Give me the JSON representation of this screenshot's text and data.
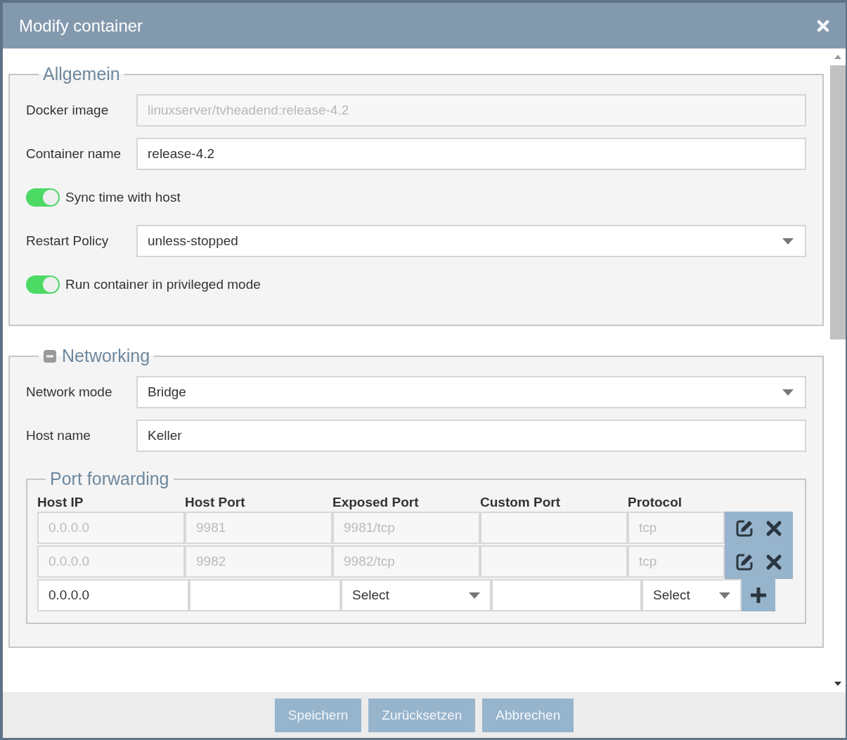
{
  "dialog": {
    "title": "Modify container"
  },
  "sections": [
    {
      "legend": "Allgemein",
      "fields": [
        {
          "kind": "text",
          "label": "Docker image",
          "value": "linuxserver/tvheadend:release-4.2",
          "disabled": true
        },
        {
          "kind": "text",
          "label": "Container name",
          "value": "release-4.2",
          "disabled": false
        },
        {
          "kind": "toggle",
          "label": "Sync time with host",
          "on": true
        },
        {
          "kind": "select",
          "label": "Restart Policy",
          "value": "unless-stopped"
        },
        {
          "kind": "toggle",
          "label": "Run container in privileged mode",
          "on": true
        }
      ]
    },
    {
      "legend": "Networking",
      "expanded": true,
      "fields": [
        {
          "kind": "select",
          "label": "Network mode",
          "value": "Bridge"
        },
        {
          "kind": "text",
          "label": "Host name",
          "value": "Keller",
          "disabled": false
        }
      ],
      "port_forwarding": {
        "legend": "Port forwarding",
        "columns": [
          "Host IP",
          "Host Port",
          "Exposed Port",
          "Custom Port",
          "Protocol"
        ],
        "rows": [
          {
            "host_ip": "0.0.0.0",
            "host_port": "9981",
            "exposed_port": "9981/tcp",
            "protocol": "tcp",
            "disabled": true
          },
          {
            "host_ip": "0.0.0.0",
            "host_port": "9982",
            "exposed_port": "9982/tcp",
            "protocol": "tcp",
            "disabled": true
          }
        ],
        "new_row": {
          "host_ip": "0.0.0.0",
          "exposed_port": "Select",
          "protocol": "Select"
        }
      }
    }
  ],
  "buttons": [
    {
      "label": "Speichern"
    },
    {
      "label": "Zurücksetzen"
    },
    {
      "label": "Abbrechen"
    }
  ]
}
